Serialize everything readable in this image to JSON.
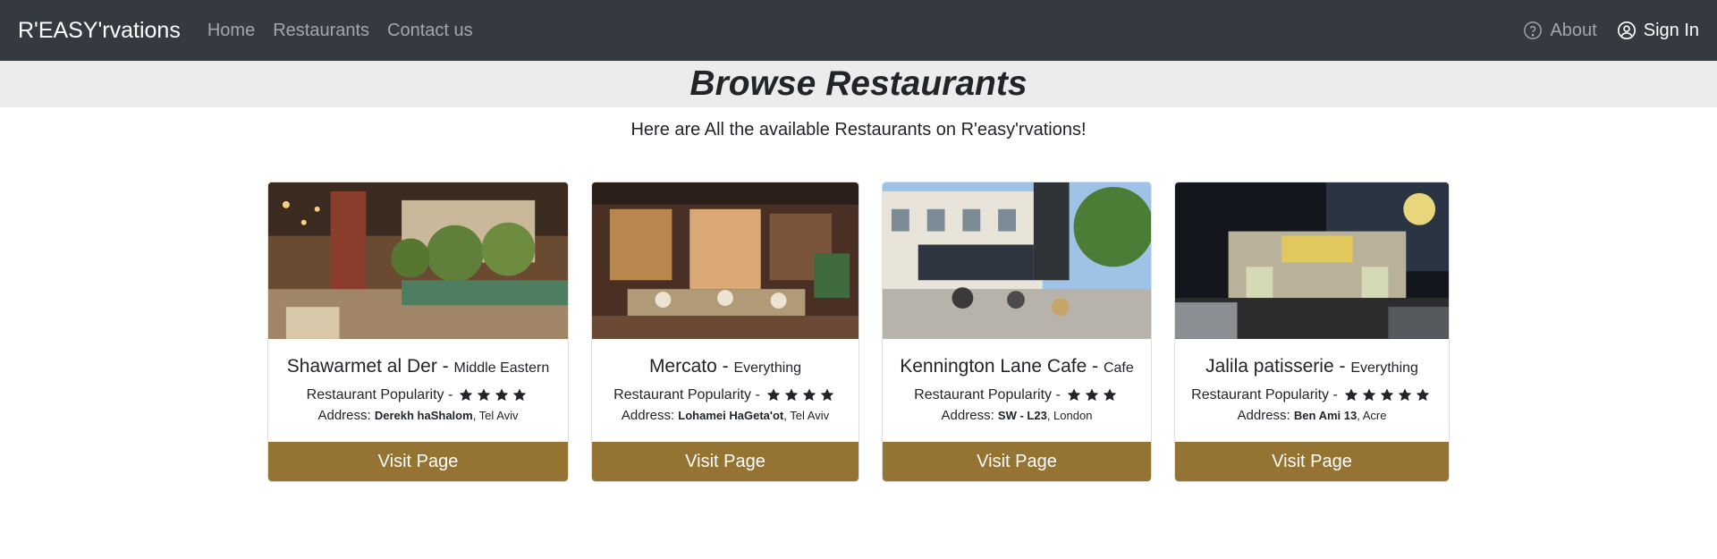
{
  "nav": {
    "brand": "R'EASY'rvations",
    "links": [
      "Home",
      "Restaurants",
      "Contact us"
    ],
    "about": "About",
    "sign_in": "Sign In"
  },
  "header": {
    "title": "Browse Restaurants",
    "subtitle": "Here are All the available Restaurants on R'easy'rvations!"
  },
  "restaurants": [
    {
      "name": "Shawarmet al Der",
      "sep": " - ",
      "cuisine": "Middle Eastern",
      "popularity_label": "Restaurant Popularity - ",
      "stars": 4,
      "address_label": "Address: ",
      "street": "Derekh haShalom",
      "city": ", Tel Aviv",
      "button": "Visit Page"
    },
    {
      "name": "Mercato",
      "sep": " - ",
      "cuisine": "Everything",
      "popularity_label": "Restaurant Popularity - ",
      "stars": 4,
      "address_label": "Address: ",
      "street": "Lohamei HaGeta'ot",
      "city": ", Tel Aviv",
      "button": "Visit Page"
    },
    {
      "name": "Kennington Lane Cafe",
      "sep": " - ",
      "cuisine": "Cafe",
      "popularity_label": "Restaurant Popularity - ",
      "stars": 3,
      "address_label": "Address: ",
      "street": "SW - L23",
      "city": ", London",
      "button": "Visit Page"
    },
    {
      "name": "Jalila patisserie",
      "sep": " - ",
      "cuisine": "Everything",
      "popularity_label": "Restaurant Popularity - ",
      "stars": 5,
      "address_label": "Address: ",
      "street": "Ben Ami 13",
      "city": ", Acre",
      "button": "Visit Page"
    }
  ],
  "colors": {
    "navbar": "#343a40",
    "accent_button": "#947333",
    "title_band": "#ececec"
  }
}
